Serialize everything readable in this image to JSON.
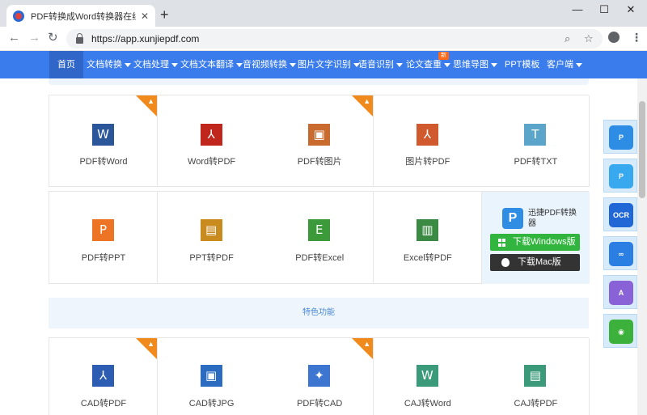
{
  "browser": {
    "tab_title": "PDF转换成Word转换器在线免费",
    "tab_close": "✕",
    "new_tab": "+",
    "url": "https://app.xunjiepdf.com",
    "win_min": "—",
    "win_max": "☐",
    "win_close": "✕"
  },
  "nav": {
    "items": [
      {
        "label": "首页",
        "dropdown": false
      },
      {
        "label": "文档转换",
        "dropdown": true
      },
      {
        "label": "文档处理",
        "dropdown": true
      },
      {
        "label": "文档文本翻译",
        "dropdown": true
      },
      {
        "label": "音视频转换",
        "dropdown": true
      },
      {
        "label": "图片文字识别",
        "dropdown": true
      },
      {
        "label": "语音识别",
        "dropdown": true
      },
      {
        "label": "论文查重",
        "dropdown": true
      },
      {
        "label": "思维导图",
        "dropdown": true
      },
      {
        "label": "PPT模板",
        "dropdown": false
      },
      {
        "label": "客户端",
        "dropdown": true
      }
    ],
    "new_badge": "新"
  },
  "tools_row1": [
    {
      "label": "PDF转Word",
      "icon": "W",
      "icon_name": "word-file-icon",
      "color": "#2b579a",
      "hot": true
    },
    {
      "label": "Word转PDF",
      "icon": "⅄",
      "icon_name": "pdf-file-icon",
      "color": "#c0261b",
      "hot": false
    },
    {
      "label": "PDF转图片",
      "icon": "▣",
      "icon_name": "image-file-icon",
      "color": "#c96a2e",
      "hot": true
    },
    {
      "label": "图片转PDF",
      "icon": "⅄",
      "icon_name": "pdf-file-icon",
      "color": "#d05a2e",
      "hot": false
    },
    {
      "label": "PDF转TXT",
      "icon": "T",
      "icon_name": "txt-file-icon",
      "color": "#5aa5c9",
      "hot": false
    }
  ],
  "tools_row2": [
    {
      "label": "PDF转PPT",
      "icon": "P",
      "icon_name": "ppt-file-icon",
      "color": "#ed7425",
      "hot": false
    },
    {
      "label": "PPT转PDF",
      "icon": "▤",
      "icon_name": "ppt-pdf-file-icon",
      "color": "#c98a1e",
      "hot": false
    },
    {
      "label": "PDF转Excel",
      "icon": "E",
      "icon_name": "excel-file-icon",
      "color": "#3c9a3a",
      "hot": false
    },
    {
      "label": "Excel转PDF",
      "icon": "▥",
      "icon_name": "excel-pdf-file-icon",
      "color": "#3b8a43",
      "hot": false
    }
  ],
  "promo": {
    "logo": "P",
    "text": "迅捷PDF转换器",
    "windows_btn": "下载Windows版",
    "mac_btn": "下载Mac版"
  },
  "feature_band_title": "特色功能",
  "tools_row3": [
    {
      "label": "CAD转PDF",
      "icon": "⅄",
      "icon_name": "pdf-file-icon",
      "color": "#2c5db3",
      "hot": true
    },
    {
      "label": "CAD转JPG",
      "icon": "▣",
      "icon_name": "image-file-icon",
      "color": "#2c6cc0",
      "hot": false
    },
    {
      "label": "PDF转CAD",
      "icon": "✦",
      "icon_name": "cad-file-icon",
      "color": "#3c76d0",
      "hot": true
    },
    {
      "label": "CAJ转Word",
      "icon": "W",
      "icon_name": "word-file-icon",
      "color": "#3a9a7a",
      "hot": false
    },
    {
      "label": "CAJ转PDF",
      "icon": "▤",
      "icon_name": "document-file-icon",
      "color": "#3a9a7a",
      "hot": false
    }
  ],
  "sidebar": [
    {
      "label": "P",
      "icon_name": "pdf-app-icon",
      "color": "#2d8de5"
    },
    {
      "label": "P",
      "icon_name": "pdf-editor-icon",
      "color": "#38a8ef"
    },
    {
      "label": "OCR",
      "icon_name": "ocr-icon",
      "color": "#2168d6"
    },
    {
      "label": "∞",
      "icon_name": "link-icon",
      "color": "#2b7fe3"
    },
    {
      "label": "A",
      "icon_name": "translate-icon",
      "color": "#8a62d8"
    },
    {
      "label": "◉",
      "icon_name": "wechat-icon",
      "color": "#3bb03a"
    }
  ]
}
